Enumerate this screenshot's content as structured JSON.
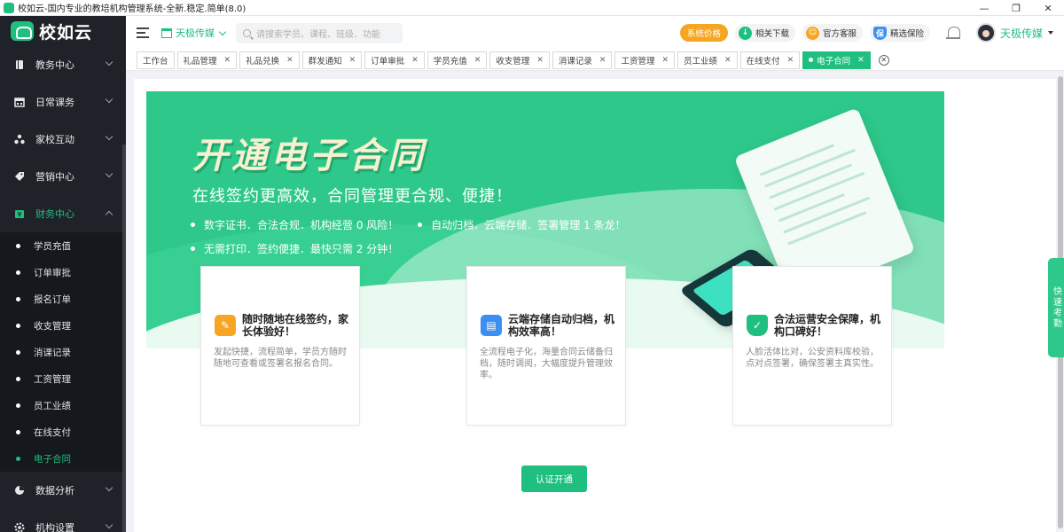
{
  "window": {
    "title": "校如云-国内专业的教培机构管理系统-全新.稳定.简单(8.0)",
    "controls": {
      "minimize": "—",
      "maximize": "❐",
      "close": "✕"
    }
  },
  "brand": {
    "name": "校如云"
  },
  "sidebar": {
    "items": [
      {
        "label": "教务中心",
        "icon": "book-icon"
      },
      {
        "label": "日常课务",
        "icon": "calendar-icon"
      },
      {
        "label": "家校互动",
        "icon": "people-icon"
      },
      {
        "label": "营销中心",
        "icon": "tag-icon"
      },
      {
        "label": "财务中心",
        "icon": "wallet-icon",
        "expanded": true
      },
      {
        "label": "数据分析",
        "icon": "chart-icon"
      },
      {
        "label": "机构设置",
        "icon": "settings-icon"
      }
    ],
    "finance_submenu": [
      {
        "label": "学员充值"
      },
      {
        "label": "订单审批"
      },
      {
        "label": "报名订单"
      },
      {
        "label": "收支管理"
      },
      {
        "label": "消课记录"
      },
      {
        "label": "工资管理"
      },
      {
        "label": "员工业绩"
      },
      {
        "label": "在线支付"
      },
      {
        "label": "电子合同",
        "active": true
      }
    ]
  },
  "topbar": {
    "org_name": "天极传媒",
    "search_placeholder": "请搜索学员、课程、班级、功能",
    "system_price": "系统价格",
    "downloads": "相关下载",
    "support": "官方客服",
    "insurance": "精选保险",
    "insurance_badge": "保",
    "user_name": "天极传媒"
  },
  "tabs": [
    {
      "label": "工作台",
      "closable": false
    },
    {
      "label": "礼品管理",
      "closable": true
    },
    {
      "label": "礼品兑换",
      "closable": true
    },
    {
      "label": "群发通知",
      "closable": true
    },
    {
      "label": "订单审批",
      "closable": true
    },
    {
      "label": "学员充值",
      "closable": true
    },
    {
      "label": "收支管理",
      "closable": true
    },
    {
      "label": "消课记录",
      "closable": true
    },
    {
      "label": "工资管理",
      "closable": true
    },
    {
      "label": "员工业绩",
      "closable": true
    },
    {
      "label": "在线支付",
      "closable": true
    },
    {
      "label": "电子合同",
      "closable": true,
      "active": true
    }
  ],
  "banner": {
    "title": "开通电子合同",
    "subtitle": "在线签约更高效，合同管理更合规、便捷！",
    "bullets": [
      "数字证书．合法合规．机构经营 0 风险！",
      "自动归档．云端存储．签署管理 1 条龙！",
      "无需打印．签约便捷．最快只需 2 分钟！"
    ]
  },
  "features": [
    {
      "title": "随时随地在线签约，家长体验好！",
      "desc": "发起快捷，流程简单，学员方随时随地可查看或签署名报名合同。",
      "icon": "pencil-icon",
      "color": "#f6a623"
    },
    {
      "title": "云端存储自动归档，机构效率高！",
      "desc": "全流程电子化，海量合同云储备归档，随时调阅，大幅度提升管理效率。",
      "icon": "archive-icon",
      "color": "#3b8ff0"
    },
    {
      "title": "合法运营安全保障，机构口碑好！",
      "desc": "人脸活体比对，公安资料库校验，点对点签署，确保签署主真实性。",
      "icon": "shield-icon",
      "color": "#1fbf7f"
    }
  ],
  "cta": {
    "label": "认证开通"
  },
  "quick_tab": {
    "label": "快速考勤"
  },
  "colors": {
    "accent": "#1fbf7f",
    "sidebar_bg": "#1f2329",
    "banner_bg": "#2ec98a",
    "orange": "#f5a623"
  }
}
